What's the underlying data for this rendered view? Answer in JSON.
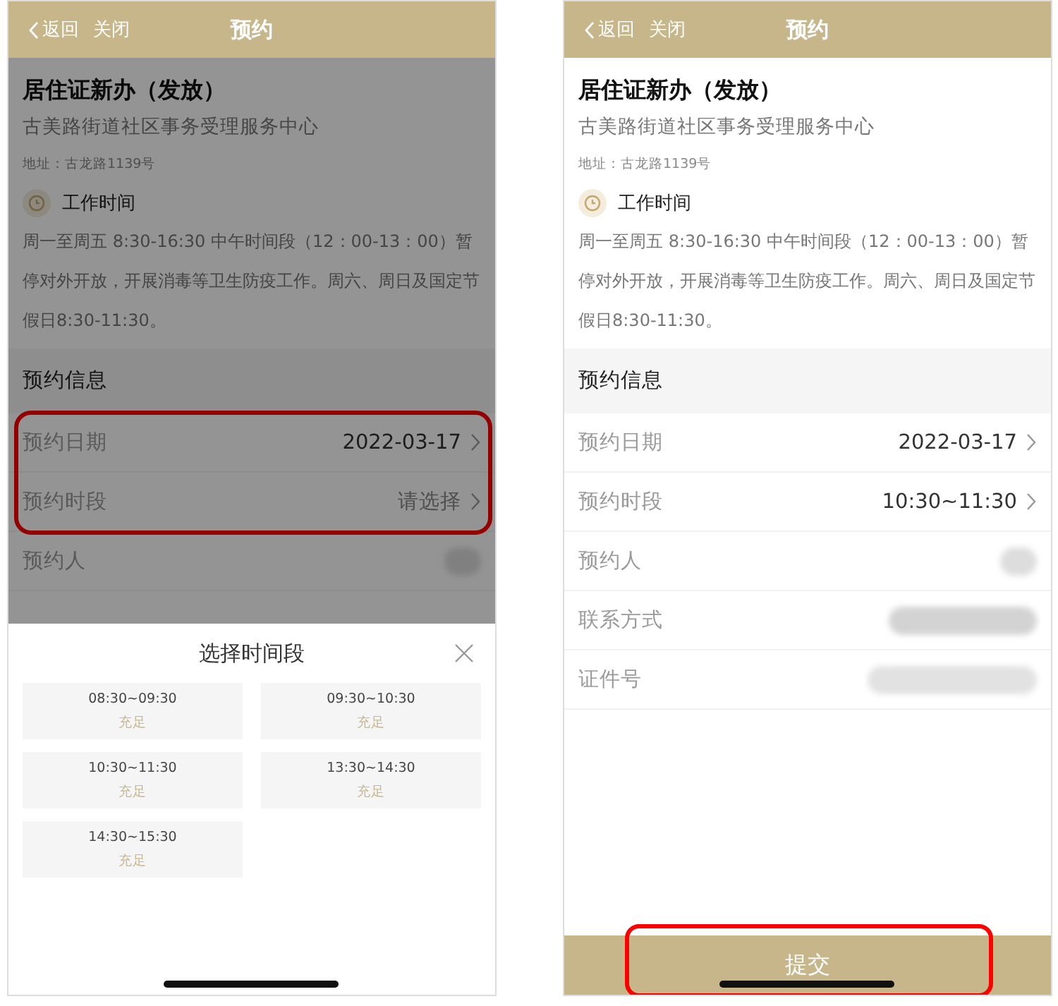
{
  "screens": [
    {
      "header": {
        "back": "返回",
        "close": "关闭",
        "title": "预约"
      },
      "dimmed": true,
      "service": {
        "title": "居住证新办（发放）",
        "center": "古美路街道社区事务受理服务中心",
        "address": "地址：古龙路1139号",
        "hours_label": "工作时间",
        "hours": "周一至周五 8:30-16:30 中午时间段（12：00-13：00）暂停对外开放，开展消毒等卫生防疫工作。周六、周日及国定节假日8:30-11:30。"
      },
      "section_title": "预约信息",
      "fields_highlighted": true,
      "fields": [
        {
          "label": "预约日期",
          "kind": "select",
          "value": "2022-03-17"
        },
        {
          "label": "预约时段",
          "kind": "select",
          "placeholder": "请选择"
        },
        {
          "label": "预约人",
          "kind": "redacted"
        }
      ],
      "time_sheet": {
        "title": "选择时间段",
        "slots": [
          {
            "time": "08:30~09:30",
            "status": "充足"
          },
          {
            "time": "09:30~10:30",
            "status": "充足"
          },
          {
            "time": "10:30~11:30",
            "status": "充足"
          },
          {
            "time": "13:30~14:30",
            "status": "充足"
          },
          {
            "time": "14:30~15:30",
            "status": "充足"
          }
        ]
      }
    },
    {
      "header": {
        "back": "返回",
        "close": "关闭",
        "title": "预约"
      },
      "dimmed": false,
      "service": {
        "title": "居住证新办（发放）",
        "center": "古美路街道社区事务受理服务中心",
        "address": "地址：古龙路1139号",
        "hours_label": "工作时间",
        "hours": "周一至周五 8:30-16:30 中午时间段（12：00-13：00）暂停对外开放，开展消毒等卫生防疫工作。周六、周日及国定节假日8:30-11:30。"
      },
      "section_title": "预约信息",
      "fields_highlighted": false,
      "fields": [
        {
          "label": "预约日期",
          "kind": "select",
          "value": "2022-03-17"
        },
        {
          "label": "预约时段",
          "kind": "select",
          "value": "10:30~11:30"
        },
        {
          "label": "预约人",
          "kind": "redacted"
        },
        {
          "label": "联系方式",
          "kind": "redacted"
        },
        {
          "label": "证件号",
          "kind": "redacted"
        }
      ],
      "submit_button": {
        "label": "提交",
        "highlighted": true
      }
    }
  ]
}
